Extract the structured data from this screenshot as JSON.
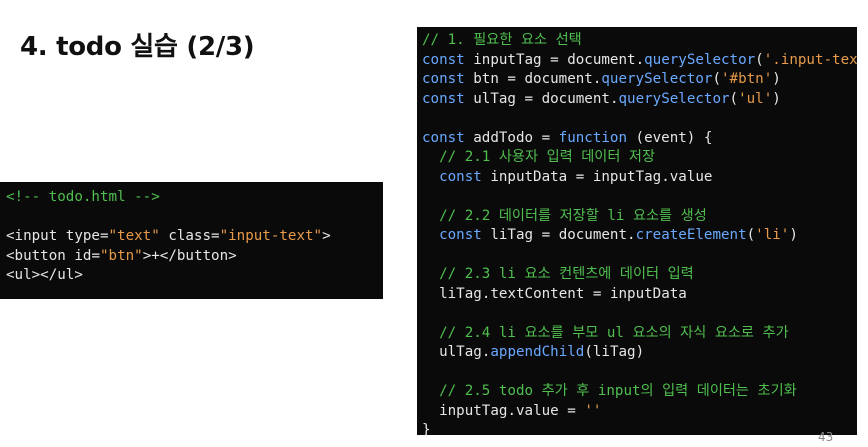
{
  "slide": {
    "title": "4. todo 실습 (2/3)",
    "page_number": "43"
  },
  "html_code": {
    "comment": "<!-- todo.html -->",
    "line1": [
      "<input ",
      "type",
      "=",
      "\"text\"",
      " ",
      "class",
      "=",
      "\"input-text\"",
      ">"
    ],
    "line2": [
      "<button ",
      "id",
      "=",
      "\"btn\"",
      ">+</button>"
    ],
    "line3": [
      "<ul></ul>"
    ]
  },
  "js_code": {
    "l1": "// 1. 필요한 요소 선택",
    "l2": [
      "const ",
      "inputTag",
      " = ",
      "document",
      ".",
      "querySelector",
      "(",
      "'.input-text'",
      ")"
    ],
    "l3": [
      "const ",
      "btn",
      " = ",
      "document",
      ".",
      "querySelector",
      "(",
      "'#btn'",
      ")"
    ],
    "l4": [
      "const ",
      "ulTag",
      " = ",
      "document",
      ".",
      "querySelector",
      "(",
      "'ul'",
      ")"
    ],
    "l6": [
      "const ",
      "addTodo",
      " = ",
      "function",
      " (event) {"
    ],
    "l7": "  // 2.1 사용자 입력 데이터 저장",
    "l8": [
      "  const ",
      "inputData",
      " = ",
      "inputTag",
      ".",
      "value"
    ],
    "l10": "  // 2.2 데이터를 저장할 li 요소를 생성",
    "l11": [
      "  const ",
      "liTag",
      " = ",
      "document",
      ".",
      "createElement",
      "(",
      "'li'",
      ")"
    ],
    "l13": "  // 2.3 li 요소 컨텐츠에 데이터 입력",
    "l14": [
      "  ",
      "liTag",
      ".",
      "textContent",
      " = ",
      "inputData"
    ],
    "l16": "  // 2.4 li 요소를 부모 ul 요소의 자식 요소로 추가",
    "l17": [
      "  ",
      "ulTag",
      ".",
      "appendChild",
      "(",
      "liTag",
      ")"
    ],
    "l19": "  // 2.5 todo 추가 후 input의 입력 데이터는 초기화",
    "l20": [
      "  ",
      "inputTag",
      ".",
      "value",
      " = ",
      "''"
    ],
    "l21": "}"
  }
}
